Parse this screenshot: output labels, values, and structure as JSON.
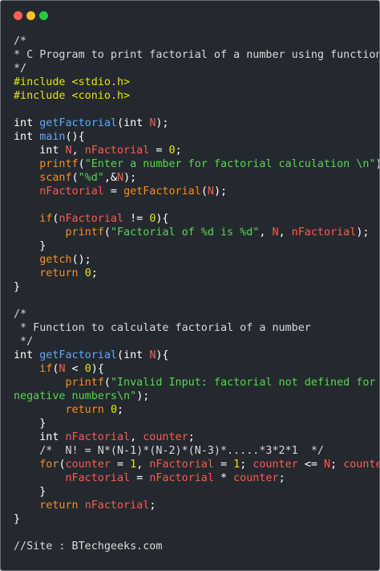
{
  "window": {
    "title_dots": [
      "close",
      "minimize",
      "maximize"
    ],
    "colors": {
      "background": "#24292f",
      "red": "#ff5f56",
      "yellow": "#ffbd2e",
      "green": "#27c93f"
    }
  },
  "code_lines": [
    [
      {
        "t": "/*",
        "c": "comment"
      }
    ],
    [
      {
        "t": "* C Program to print factorial of a number using function",
        "c": "comment"
      }
    ],
    [
      {
        "t": "*/",
        "c": "comment"
      }
    ],
    [
      {
        "t": "#include <stdio.h>",
        "c": "preproc"
      }
    ],
    [
      {
        "t": "#include <conio.h>",
        "c": "preproc"
      }
    ],
    [],
    [
      {
        "t": "int ",
        "c": "keyword"
      },
      {
        "t": "getFactorial",
        "c": "func"
      },
      {
        "t": "(",
        "c": "plain"
      },
      {
        "t": "int ",
        "c": "keyword"
      },
      {
        "t": "N",
        "c": "var"
      },
      {
        "t": ");",
        "c": "plain"
      }
    ],
    [
      {
        "t": "int ",
        "c": "keyword"
      },
      {
        "t": "main",
        "c": "func"
      },
      {
        "t": "(){",
        "c": "plain"
      }
    ],
    [
      {
        "t": "    int ",
        "c": "keyword"
      },
      {
        "t": "N",
        "c": "var"
      },
      {
        "t": ", ",
        "c": "plain"
      },
      {
        "t": "nFactorial",
        "c": "var"
      },
      {
        "t": " = ",
        "c": "plain"
      },
      {
        "t": "0",
        "c": "num"
      },
      {
        "t": ";",
        "c": "plain"
      }
    ],
    [
      {
        "t": "    ",
        "c": "plain"
      },
      {
        "t": "printf",
        "c": "callfn"
      },
      {
        "t": "(",
        "c": "plain"
      },
      {
        "t": "\"Enter a number for factorial calculation \\n\"",
        "c": "str"
      },
      {
        "t": ");",
        "c": "plain"
      }
    ],
    [
      {
        "t": "    ",
        "c": "plain"
      },
      {
        "t": "scanf",
        "c": "callfn"
      },
      {
        "t": "(",
        "c": "plain"
      },
      {
        "t": "\"%d\"",
        "c": "str"
      },
      {
        "t": ",&",
        "c": "plain"
      },
      {
        "t": "N",
        "c": "var"
      },
      {
        "t": ");",
        "c": "plain"
      }
    ],
    [
      {
        "t": "    ",
        "c": "plain"
      },
      {
        "t": "nFactorial",
        "c": "var"
      },
      {
        "t": " = ",
        "c": "plain"
      },
      {
        "t": "getFactorial",
        "c": "callfn"
      },
      {
        "t": "(",
        "c": "plain"
      },
      {
        "t": "N",
        "c": "var"
      },
      {
        "t": ");",
        "c": "plain"
      }
    ],
    [],
    [
      {
        "t": "    if",
        "c": "callfn"
      },
      {
        "t": "(",
        "c": "plain"
      },
      {
        "t": "nFactorial",
        "c": "var"
      },
      {
        "t": " != ",
        "c": "plain"
      },
      {
        "t": "0",
        "c": "num"
      },
      {
        "t": "){",
        "c": "plain"
      }
    ],
    [
      {
        "t": "        ",
        "c": "plain"
      },
      {
        "t": "printf",
        "c": "callfn"
      },
      {
        "t": "(",
        "c": "plain"
      },
      {
        "t": "\"Factorial of %d is %d\"",
        "c": "str"
      },
      {
        "t": ", ",
        "c": "plain"
      },
      {
        "t": "N",
        "c": "var"
      },
      {
        "t": ", ",
        "c": "plain"
      },
      {
        "t": "nFactorial",
        "c": "var"
      },
      {
        "t": ");",
        "c": "plain"
      }
    ],
    [
      {
        "t": "    }",
        "c": "plain"
      }
    ],
    [
      {
        "t": "    ",
        "c": "plain"
      },
      {
        "t": "getch",
        "c": "callfn"
      },
      {
        "t": "();",
        "c": "plain"
      }
    ],
    [
      {
        "t": "    ",
        "c": "plain"
      },
      {
        "t": "return",
        "c": "callfn"
      },
      {
        "t": " ",
        "c": "plain"
      },
      {
        "t": "0",
        "c": "num"
      },
      {
        "t": ";",
        "c": "plain"
      }
    ],
    [
      {
        "t": "}",
        "c": "plain"
      }
    ],
    [],
    [
      {
        "t": "/*",
        "c": "comment"
      }
    ],
    [
      {
        "t": " * Function to calculate factorial of a number",
        "c": "comment"
      }
    ],
    [
      {
        "t": " */",
        "c": "comment"
      }
    ],
    [
      {
        "t": "int ",
        "c": "keyword"
      },
      {
        "t": "getFactorial",
        "c": "func"
      },
      {
        "t": "(",
        "c": "plain"
      },
      {
        "t": "int ",
        "c": "keyword"
      },
      {
        "t": "N",
        "c": "var"
      },
      {
        "t": "){",
        "c": "plain"
      }
    ],
    [
      {
        "t": "    if",
        "c": "callfn"
      },
      {
        "t": "(",
        "c": "plain"
      },
      {
        "t": "N",
        "c": "var"
      },
      {
        "t": " < ",
        "c": "plain"
      },
      {
        "t": "0",
        "c": "num"
      },
      {
        "t": "){",
        "c": "plain"
      }
    ],
    [
      {
        "t": "        ",
        "c": "plain"
      },
      {
        "t": "printf",
        "c": "callfn"
      },
      {
        "t": "(",
        "c": "plain"
      },
      {
        "t": "\"Invalid Input: factorial not defined for \\",
        "c": "str"
      }
    ],
    [
      {
        "t": "negative numbers\\n\"",
        "c": "str"
      },
      {
        "t": ");",
        "c": "plain"
      }
    ],
    [
      {
        "t": "        ",
        "c": "plain"
      },
      {
        "t": "return",
        "c": "callfn"
      },
      {
        "t": " ",
        "c": "plain"
      },
      {
        "t": "0",
        "c": "num"
      },
      {
        "t": ";",
        "c": "plain"
      }
    ],
    [
      {
        "t": "    }",
        "c": "plain"
      }
    ],
    [
      {
        "t": "    int ",
        "c": "keyword"
      },
      {
        "t": "nFactorial",
        "c": "var"
      },
      {
        "t": ", ",
        "c": "plain"
      },
      {
        "t": "counter",
        "c": "var"
      },
      {
        "t": ";",
        "c": "plain"
      }
    ],
    [
      {
        "t": "    /*  N! = N*(N-1)*(N-2)*(N-3)*.....*3*2*1  */",
        "c": "comment"
      }
    ],
    [
      {
        "t": "    for",
        "c": "callfn"
      },
      {
        "t": "(",
        "c": "plain"
      },
      {
        "t": "counter",
        "c": "var"
      },
      {
        "t": " = ",
        "c": "plain"
      },
      {
        "t": "1",
        "c": "num"
      },
      {
        "t": ", ",
        "c": "plain"
      },
      {
        "t": "nFactorial",
        "c": "var"
      },
      {
        "t": " = ",
        "c": "plain"
      },
      {
        "t": "1",
        "c": "num"
      },
      {
        "t": "; ",
        "c": "plain"
      },
      {
        "t": "counter",
        "c": "var"
      },
      {
        "t": " <= ",
        "c": "plain"
      },
      {
        "t": "N",
        "c": "var"
      },
      {
        "t": "; ",
        "c": "plain"
      },
      {
        "t": "counter",
        "c": "var"
      },
      {
        "t": "++){",
        "c": "plain"
      }
    ],
    [
      {
        "t": "        ",
        "c": "plain"
      },
      {
        "t": "nFactorial",
        "c": "var"
      },
      {
        "t": " = ",
        "c": "plain"
      },
      {
        "t": "nFactorial",
        "c": "var"
      },
      {
        "t": " * ",
        "c": "plain"
      },
      {
        "t": "counter",
        "c": "var"
      },
      {
        "t": ";",
        "c": "plain"
      }
    ],
    [
      {
        "t": "    }",
        "c": "plain"
      }
    ],
    [
      {
        "t": "    ",
        "c": "plain"
      },
      {
        "t": "return",
        "c": "callfn"
      },
      {
        "t": " ",
        "c": "plain"
      },
      {
        "t": "nFactorial",
        "c": "var"
      },
      {
        "t": ";",
        "c": "plain"
      }
    ],
    [
      {
        "t": "}",
        "c": "plain"
      }
    ],
    [],
    [
      {
        "t": "//Site : BTechgeeks.com",
        "c": "comment"
      }
    ]
  ]
}
